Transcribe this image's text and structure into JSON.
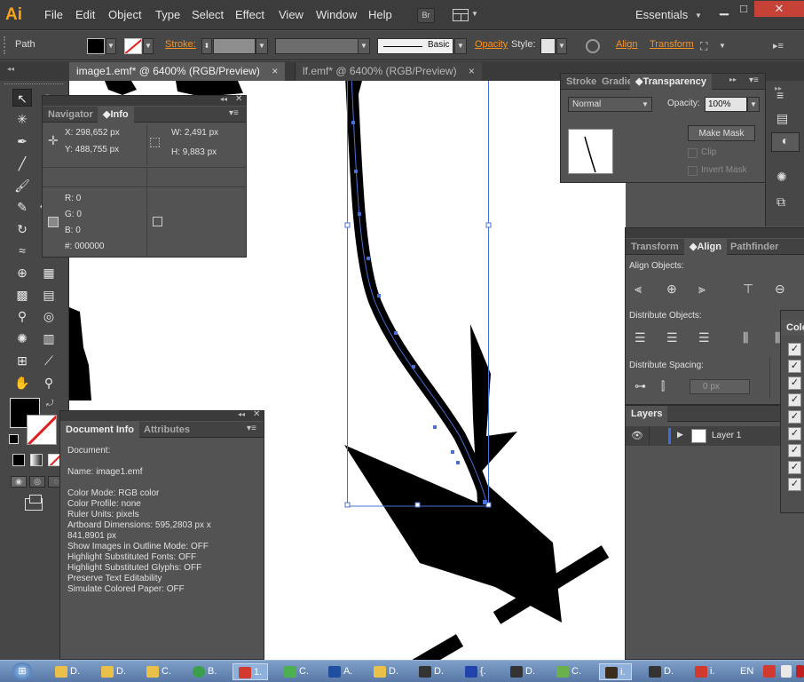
{
  "app": {
    "logo": "Ai"
  },
  "menu": [
    "File",
    "Edit",
    "Object",
    "Type",
    "Select",
    "Effect",
    "View",
    "Window",
    "Help"
  ],
  "toolbar_right": {
    "bridge": "Br",
    "workspace": "Essentials"
  },
  "control": {
    "selection": "Path",
    "stroke_label": "Stroke:",
    "brush": "Basic",
    "opacity_label": "Opacity",
    "style_label": "Style:",
    "align_label": "Align",
    "transform_label": "Transform"
  },
  "tabs": [
    {
      "label": "image1.emf* @ 6400% (RGB/Preview)",
      "active": true
    },
    {
      "label": "lf.emf* @ 6400% (RGB/Preview)",
      "active": false
    }
  ],
  "info_panel": {
    "tabs": [
      "Navigator",
      "Info"
    ],
    "x": "X:  298,652 px",
    "y": "Y:  488,755 px",
    "w": "W:  2,491 px",
    "h": "H:  9,883 px",
    "r": "R: 0",
    "g": "G: 0",
    "b": "B: 0",
    "hex": "#: 000000"
  },
  "doc_info": {
    "tabs": [
      "Document Info",
      "Attributes"
    ],
    "lines": [
      "Document:",
      "",
      "Name: image1.emf",
      "",
      "Color Mode: RGB color",
      "Color Profile: none",
      "Ruler Units: pixels",
      "Artboard Dimensions: 595,2803 px x",
      "841,8901 px",
      "Show Images in Outline Mode: OFF",
      "Highlight Substituted Fonts: OFF",
      "Highlight Substituted Glyphs: OFF",
      "Preserve Text Editability",
      "Simulate Colored Paper: OFF"
    ]
  },
  "transparency": {
    "tabs": [
      "Stroke",
      "Gradie",
      "Transparency"
    ],
    "mode": "Normal",
    "opacity_label": "Opacity:",
    "opacity": "100%",
    "make_mask": "Make Mask",
    "clip": "Clip",
    "invert": "Invert Mask"
  },
  "align": {
    "tabs": [
      "Transform",
      "Align",
      "Pathfinder"
    ],
    "align_objects": "Align Objects:",
    "distribute_objects": "Distribute Objects:",
    "distribute_spacing": "Distribute Spacing:",
    "spacing_value": "0 px"
  },
  "layers": {
    "title": "Layers",
    "layer_name": "Layer 1"
  },
  "color_panel": {
    "title": "Colo"
  },
  "taskbar": [
    {
      "label": "D.",
      "color": "#e8c04a"
    },
    {
      "label": "D.",
      "color": "#e8c04a"
    },
    {
      "label": "C.",
      "color": "#e8c04a"
    },
    {
      "label": "B.",
      "color": "#3a9e4a"
    },
    {
      "label": "1.",
      "color": "#d13a2e"
    },
    {
      "label": "C.",
      "color": "#4caf50"
    },
    {
      "label": "A.",
      "color": "#1f4fa0"
    },
    {
      "label": "D.",
      "color": "#e8c04a"
    },
    {
      "label": "D.",
      "color": "#333333"
    },
    {
      "label": "{.",
      "color": "#2244aa"
    },
    {
      "label": "D.",
      "color": "#333333"
    },
    {
      "label": "C.",
      "color": "#6ab04c"
    },
    {
      "label": "i.",
      "color": "#3c2c1c"
    },
    {
      "label": "D.",
      "color": "#333333"
    },
    {
      "label": "i.",
      "color": "#d13a2e"
    }
  ],
  "tray": {
    "lang": "EN"
  }
}
